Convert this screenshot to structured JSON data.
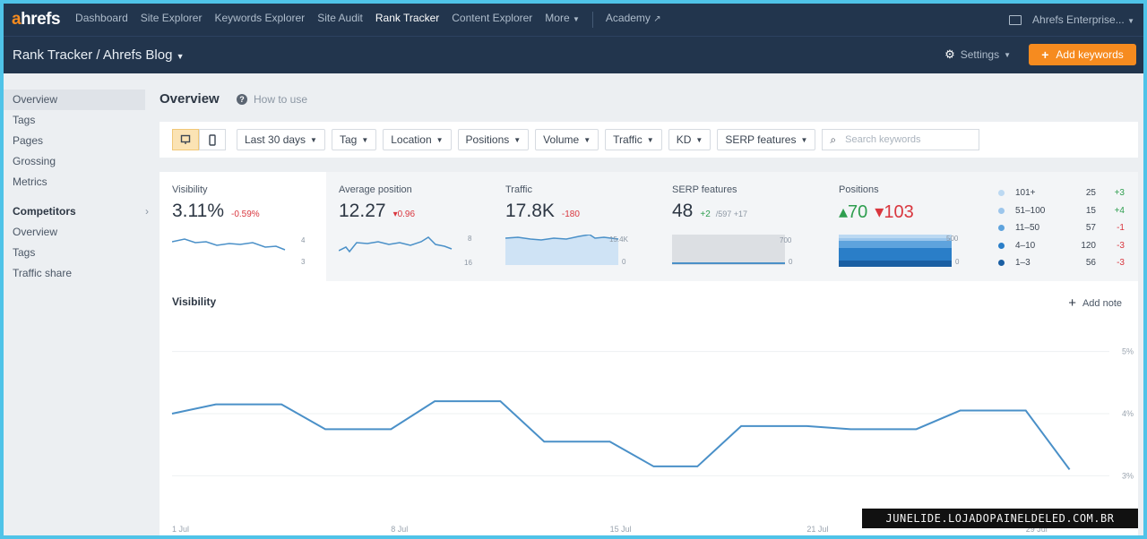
{
  "topnav": {
    "logo": "ahrefs",
    "items": [
      "Dashboard",
      "Site Explorer",
      "Keywords Explorer",
      "Site Audit",
      "Rank Tracker",
      "Content Explorer",
      "More"
    ],
    "academy": "Academy",
    "account": "Ahrefs Enterprise..."
  },
  "projbar": {
    "breadcrumb": "Rank Tracker / Ahrefs Blog",
    "settings": "Settings",
    "add_keywords": "Add keywords"
  },
  "sidebar": {
    "items": [
      "Overview",
      "Tags",
      "Pages",
      "Grossing",
      "Metrics"
    ],
    "competitors_header": "Competitors",
    "competitors_items": [
      "Overview",
      "Tags",
      "Traffic share"
    ]
  },
  "page": {
    "title": "Overview",
    "how_to_use": "How to use"
  },
  "filters": {
    "date": "Last 30 days",
    "tag": "Tag",
    "location": "Location",
    "positions": "Positions",
    "volume": "Volume",
    "traffic": "Traffic",
    "kd": "KD",
    "serp": "SERP features",
    "search_placeholder": "Search keywords"
  },
  "metrics": {
    "visibility": {
      "label": "Visibility",
      "value": "3.11%",
      "delta": "-0.59%",
      "axis_top": "4",
      "axis_bottom": "3"
    },
    "avg_position": {
      "label": "Average position",
      "value": "12.27",
      "delta": "▾0.96",
      "axis_top": "8",
      "axis_bottom": "16"
    },
    "traffic": {
      "label": "Traffic",
      "value": "17.8K",
      "delta": "-180",
      "axis_top": "15.4K",
      "axis_bottom": "0"
    },
    "serp_features": {
      "label": "SERP features",
      "value": "48",
      "delta": "+2",
      "sub": "/597 +17",
      "axis_top": "700",
      "axis_bottom": "0"
    },
    "positions": {
      "label": "Positions",
      "up": "▴70",
      "down": "▾103",
      "axis_top": "500",
      "axis_bottom": "0"
    }
  },
  "positions_legend": [
    {
      "label": "101+",
      "count": "25",
      "delta": "+3",
      "color": "#bcd9f2"
    },
    {
      "label": "51–100",
      "count": "15",
      "delta": "+4",
      "color": "#9cc6ec"
    },
    {
      "label": "11–50",
      "count": "57",
      "delta": "-1",
      "color": "#5ea3dd"
    },
    {
      "label": "4–10",
      "count": "120",
      "delta": "-3",
      "color": "#2a7ec8"
    },
    {
      "label": "1–3",
      "count": "56",
      "delta": "-3",
      "color": "#1a5fa3"
    }
  ],
  "visibility_chart": {
    "title": "Visibility",
    "add_note": "Add note",
    "y_ticks": [
      "5%",
      "4%",
      "3%"
    ],
    "x_ticks": [
      "1 Jul",
      "8 Jul",
      "15 Jul",
      "21 Jul",
      "29 Jul"
    ]
  },
  "chart_data": {
    "type": "line",
    "x": [
      1,
      3,
      6,
      8,
      11,
      13,
      16,
      18,
      21,
      23,
      25,
      27,
      30,
      32,
      35,
      37,
      40,
      42
    ],
    "values": [
      4.0,
      4.15,
      4.15,
      3.75,
      3.75,
      4.2,
      4.2,
      3.55,
      3.55,
      3.15,
      3.15,
      3.8,
      3.8,
      3.75,
      3.75,
      4.05,
      4.05,
      3.1
    ],
    "y_ticks": [
      "5%",
      "4%",
      "3%"
    ],
    "x_ticks": [
      "1 Jul",
      "8 Jul",
      "15 Jul",
      "21 Jul",
      "29 Jul"
    ],
    "title": "Visibility",
    "ylim": [
      2.5,
      5.5
    ],
    "color": "#4a90c8"
  },
  "watermark": "JUNELIDE.LOJADOPAINELDELED.COM.BR"
}
